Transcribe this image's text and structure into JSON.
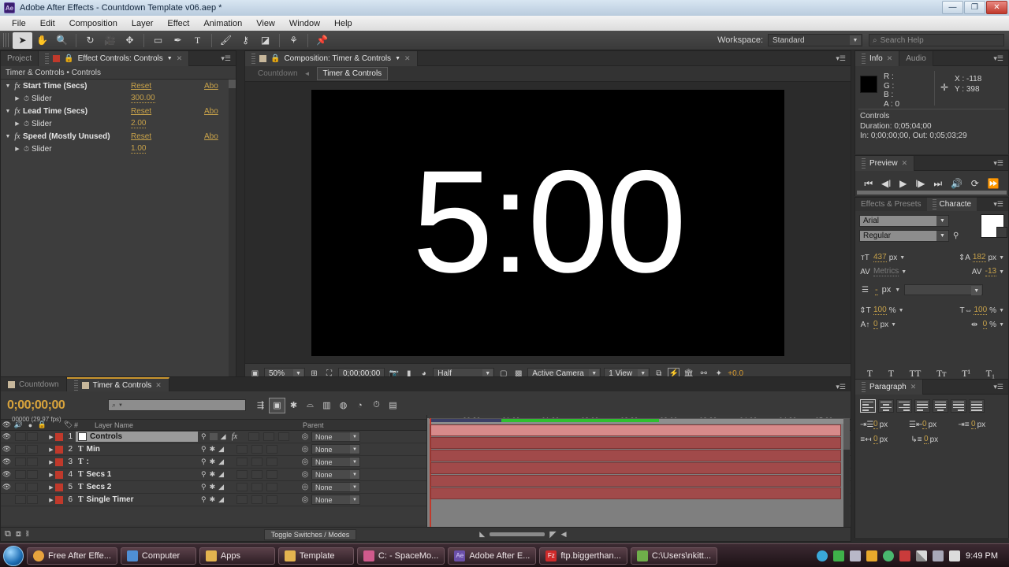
{
  "window": {
    "title": "Adobe After Effects - Countdown Template v06.aep *",
    "app_badge": "Ae",
    "minimize": "—",
    "maximize": "❐",
    "close": "✕"
  },
  "menu": {
    "items": [
      "File",
      "Edit",
      "Composition",
      "Layer",
      "Effect",
      "Animation",
      "View",
      "Window",
      "Help"
    ]
  },
  "toolbar": {
    "workspace_label": "Workspace:",
    "workspace_value": "Standard",
    "search_placeholder": "Search Help",
    "search_icon": "search-icon"
  },
  "effect_controls": {
    "tab_project": "Project",
    "tab_title": "Effect Controls: Controls",
    "breadcrumb": "Timer & Controls • Controls",
    "effects": [
      {
        "name": "Start Time (Secs)",
        "reset": "Reset",
        "about": "Abo",
        "prop": "Slider",
        "value": "300.00"
      },
      {
        "name": "Lead Time (Secs)",
        "reset": "Reset",
        "about": "Abo",
        "prop": "Slider",
        "value": "2.00"
      },
      {
        "name": "Speed (Mostly Unused)",
        "reset": "Reset",
        "about": "Abo",
        "prop": "Slider",
        "value": "1.00"
      }
    ]
  },
  "composition": {
    "tab_title": "Composition: Timer & Controls",
    "breadcrumb_parent": "Countdown",
    "breadcrumb_current": "Timer & Controls",
    "canvas_text": "5:00",
    "bottom": {
      "zoom": "50%",
      "timecode": "0;00;00;00",
      "resolution": "Half",
      "camera": "Active Camera",
      "views": "1 View",
      "exposure": "+0.0"
    }
  },
  "info": {
    "tab": "Info",
    "tab_audio": "Audio",
    "r": "R :",
    "g": "G :",
    "b": "B :",
    "a": "A :  0",
    "x": "X : -118",
    "y": "Y : 398",
    "layer": "Controls",
    "duration": "Duration: 0;05;04;00",
    "inout": "In: 0;00;00;00, Out: 0;05;03;29"
  },
  "preview": {
    "tab": "Preview",
    "buttons": [
      "first-frame",
      "prev-frame",
      "play",
      "next-frame",
      "last-frame",
      "audio",
      "loop",
      "ram-preview"
    ]
  },
  "character": {
    "tab_effects": "Effects & Presets",
    "tab_character": "Characte",
    "font_family": "Arial",
    "font_style": "Regular",
    "font_size": "437",
    "font_size_unit": "px",
    "leading": "182",
    "leading_unit": "px",
    "kerning": "Metrics",
    "tracking": "-13",
    "stroke_width": "-",
    "stroke_width_unit": "px",
    "vertical_scale": "100",
    "horizontal_scale": "100",
    "baseline_shift": "0",
    "baseline_unit": "px",
    "tsume": "0",
    "tsume_unit": "%",
    "styles": [
      "T",
      "T",
      "TT",
      "Tᴛ",
      "T¹",
      "T₁"
    ]
  },
  "paragraph": {
    "tab": "Paragraph",
    "indents": [
      {
        "icon": "indent-left-icon",
        "value": "0",
        "unit": "px"
      },
      {
        "icon": "indent-right-icon",
        "value": "0",
        "unit": "px"
      },
      {
        "icon": "indent-first-line-icon",
        "value": "0",
        "unit": "px"
      },
      {
        "icon": "space-before-icon",
        "value": "0",
        "unit": "px"
      },
      {
        "icon": "space-after-icon",
        "value": "0",
        "unit": "px"
      }
    ]
  },
  "timeline": {
    "tabs": [
      {
        "label": "Countdown",
        "selected": false
      },
      {
        "label": "Timer & Controls",
        "selected": true
      }
    ],
    "current_time": "0;00;00;00",
    "frame_info": "00000 (29.97 fps)",
    "search_placeholder": "",
    "columns": {
      "num": "#",
      "layer_name": "Layer Name",
      "parent": "Parent"
    },
    "layers": [
      {
        "num": "1",
        "name": "Controls",
        "type_icon": "solid-icon",
        "parent": "None",
        "selected": true,
        "visible": true,
        "has_fx": true
      },
      {
        "num": "2",
        "name": "Min",
        "type_icon": "text-icon",
        "parent": "None",
        "selected": false,
        "visible": true,
        "has_fx": false
      },
      {
        "num": "3",
        "name": ":",
        "type_icon": "text-icon",
        "parent": "None",
        "selected": false,
        "visible": true,
        "has_fx": false
      },
      {
        "num": "4",
        "name": "Secs 1",
        "type_icon": "text-icon",
        "parent": "None",
        "selected": false,
        "visible": true,
        "has_fx": false
      },
      {
        "num": "5",
        "name": "Secs 2",
        "type_icon": "text-icon",
        "parent": "None",
        "selected": false,
        "visible": true,
        "has_fx": false
      },
      {
        "num": "6",
        "name": "Single Timer",
        "type_icon": "text-icon",
        "parent": "None",
        "selected": false,
        "visible": false,
        "has_fx": false
      }
    ],
    "ruler_ticks": [
      "00:30s",
      "01:00s",
      "01:30s",
      "02:00s",
      "02:30s",
      "03:00s",
      "03:30s",
      "04:00s",
      "04:30s",
      "05:00s"
    ],
    "toggle_switches_modes": "Toggle Switches / Modes"
  },
  "taskbar": {
    "buttons": [
      {
        "label": "Free After Effe...",
        "icon_color": "#e8a33d"
      },
      {
        "label": "Computer",
        "icon_color": "#4f8fd4"
      },
      {
        "label": "Apps",
        "icon_color": "#e3b44f"
      },
      {
        "label": "Template",
        "icon_color": "#e3b44f"
      },
      {
        "label": "C: - SpaceMo...",
        "icon_color": "#d05a8c"
      },
      {
        "label": "Adobe After E...",
        "icon_color": "#6a4fa8"
      },
      {
        "label": "ftp.biggerthan...",
        "icon_color": "#cf2a2a"
      },
      {
        "label": "C:\\Users\\nkitt...",
        "icon_color": "#6fae4a"
      }
    ],
    "tray_icons": [
      "#3aa8d8",
      "#3fb14a",
      "#b8b8c8",
      "#e8a92c",
      "#49b86f",
      "#c93b3b",
      "#c8c8c8",
      "#a8a8b8",
      "#dcdcdc"
    ],
    "clock": "9:49 PM"
  }
}
